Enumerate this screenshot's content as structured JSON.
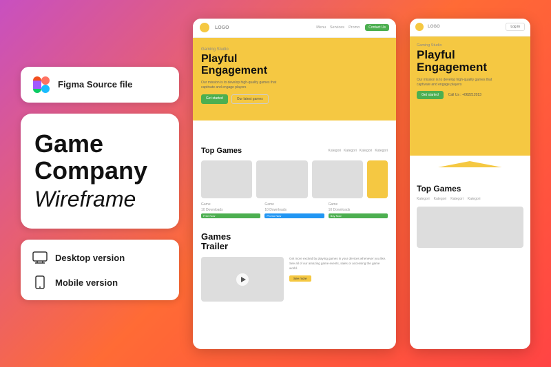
{
  "background": {
    "gradient": "linear-gradient(135deg, #c850c0 0%, #ff6b35 50%, #ff4444 100%)"
  },
  "left_panel": {
    "figma_badge": {
      "label": "Figma Source file"
    },
    "title_card": {
      "line1": "Game",
      "line2": "Company",
      "line3": "Wireframe"
    },
    "version_card": {
      "desktop": "Desktop version",
      "mobile": "Mobile version"
    }
  },
  "desktop_preview": {
    "nav": {
      "logo": "LOGO",
      "links": [
        "Menu",
        "Services",
        "Promo"
      ],
      "cta": "Contact Us"
    },
    "hero": {
      "studio": "Gaming Studio",
      "title_line1": "Playful",
      "title_line2": "Engagement",
      "desc": "Our mission is to develop high-quality games that captivate and engage players",
      "btn_primary": "Get started",
      "btn_secondary": "Our latest games"
    },
    "top_games": {
      "title": "Top Games",
      "categories": [
        "Kategori",
        "Kategori",
        "Kategori",
        "Kategori"
      ],
      "games": [
        {
          "label": "Game",
          "downloads": "10 Downloads",
          "tag": "Free Now",
          "tag_color": "green"
        },
        {
          "label": "Game",
          "downloads": "10 Downloads",
          "tag": "Promo Now",
          "tag_color": "blue"
        },
        {
          "label": "Game",
          "downloads": "10 Downloads",
          "tag": "Buy Now",
          "tag_color": "green"
        }
      ]
    },
    "games_trailer": {
      "title_line1": "Games",
      "title_line2": "Trailer",
      "desc": "Get more excited by playing games in your devices whenever you like. See all of our amazing game events, sales or accessing the game world.",
      "btn": "See more"
    }
  },
  "mobile_preview": {
    "nav": {
      "logo": "LOGO",
      "login": "Log in"
    },
    "hero": {
      "studio": "Gaming Studio",
      "title_line1": "Playful",
      "title_line2": "Engagement",
      "desc": "Our mission is to develop high-quality games that captivate and engage players",
      "btn_primary": "Get started",
      "btn_secondary": "Call Us : +062212013"
    },
    "top_games": {
      "title": "Top Games",
      "categories": [
        "Kategori",
        "Kategori",
        "Kategori",
        "Kategori"
      ]
    }
  },
  "colors": {
    "yellow": "#f5c842",
    "green": "#4CAF50",
    "blue": "#2196F3",
    "dark": "#111111",
    "gray": "#dddddd",
    "light_gray": "#999999"
  }
}
